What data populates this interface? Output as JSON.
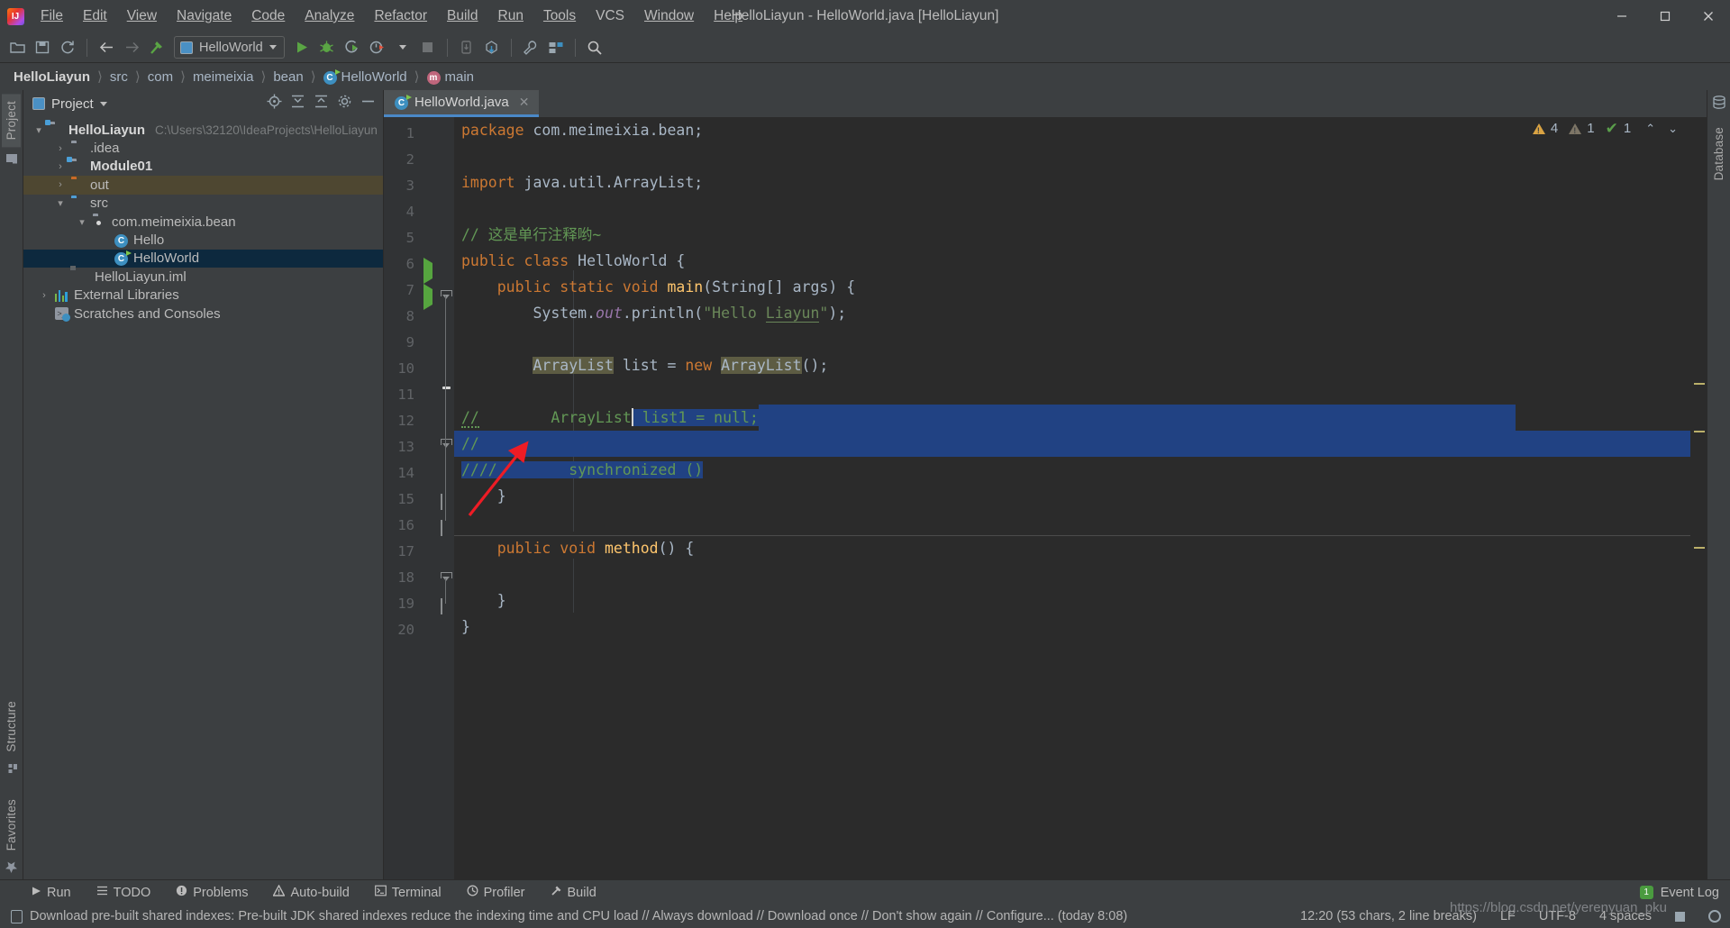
{
  "window": {
    "title": "HelloLiayun - HelloWorld.java [HelloLiayun]",
    "minimize": "—",
    "maximize": "❐",
    "close": "✕"
  },
  "menubar": [
    {
      "label": "File"
    },
    {
      "label": "Edit"
    },
    {
      "label": "View"
    },
    {
      "label": "Navigate"
    },
    {
      "label": "Code"
    },
    {
      "label": "Analyze"
    },
    {
      "label": "Refactor"
    },
    {
      "label": "Build"
    },
    {
      "label": "Run"
    },
    {
      "label": "Tools"
    },
    {
      "label": "VCS"
    },
    {
      "label": "Window"
    },
    {
      "label": "Help"
    }
  ],
  "toolbar": {
    "open_icon": "open-folder-icon",
    "save_icon": "save-icon",
    "sync_icon": "sync-icon",
    "back_icon": "back-arrow-icon",
    "forward_icon": "forward-arrow-icon",
    "build_icon": "hammer-icon",
    "run_config": "HelloWorld",
    "run_icon": "run-icon",
    "debug_icon": "debug-icon",
    "coverage_icon": "run-with-coverage-icon",
    "profile_icon": "profile-icon",
    "stop_icon": "stop-icon",
    "update_icon": "update-project-icon",
    "commit_icon": "commit-icon",
    "settings_icon": "wrench-icon",
    "project-structure_icon": "project-structure-icon",
    "search_icon": "search-everywhere-icon"
  },
  "breadcrumb": [
    {
      "label": "HelloLiayun",
      "bold": true
    },
    {
      "label": "src"
    },
    {
      "label": "com"
    },
    {
      "label": "meimeixia"
    },
    {
      "label": "bean"
    },
    {
      "label": "HelloWorld",
      "icon": "class-icon"
    },
    {
      "label": "main",
      "icon": "method-icon"
    }
  ],
  "left_rail": [
    {
      "label": "Project",
      "active": true,
      "icon": "project-icon"
    },
    {
      "label": "Structure",
      "active": false,
      "icon": "structure-icon"
    },
    {
      "label": "Favorites",
      "active": false,
      "icon": "star-icon"
    }
  ],
  "right_rail": [
    {
      "label": "Database",
      "icon": "database-icon"
    }
  ],
  "project_panel": {
    "title": "Project",
    "actions": [
      "locate-icon",
      "collapse-all-icon",
      "expand-icon",
      "settings-gear-icon",
      "hide-icon"
    ],
    "tree": [
      {
        "indent": 0,
        "arrow": "⌄",
        "icon": "module-folder",
        "label": "HelloLiayun",
        "bold": true,
        "path": "C:\\Users\\32120\\IdeaProjects\\HelloLiayun"
      },
      {
        "indent": 1,
        "arrow": "›",
        "icon": "folder",
        "label": ".idea"
      },
      {
        "indent": 1,
        "arrow": "›",
        "icon": "module-folder",
        "label": "Module01",
        "bold": true
      },
      {
        "indent": 1,
        "arrow": "›",
        "icon": "folder-orange",
        "label": "out",
        "highlight": true
      },
      {
        "indent": 1,
        "arrow": "⌄",
        "icon": "folder-blue",
        "label": "src"
      },
      {
        "indent": 2,
        "arrow": "⌄",
        "icon": "package",
        "label": "com.meimeixia.bean"
      },
      {
        "indent": 3,
        "arrow": "",
        "icon": "class",
        "label": "Hello"
      },
      {
        "indent": 3,
        "arrow": "",
        "icon": "class-runnable",
        "label": "HelloWorld",
        "selected": true
      },
      {
        "indent": 2,
        "arrow": "",
        "icon": "iml",
        "label": "HelloLiayun.iml"
      },
      {
        "indent": 0,
        "arrow": "›",
        "icon": "libraries",
        "label": "External Libraries"
      },
      {
        "indent": 0,
        "arrow": "",
        "icon": "scratches",
        "label": "Scratches and Consoles"
      }
    ]
  },
  "editor": {
    "tab": {
      "label": "HelloWorld.java",
      "icon": "java-class-icon",
      "close": "✕"
    },
    "inspections": {
      "warning_count": "4",
      "weak_warning_count": "1",
      "ok_count": "1",
      "up_arrow": "⌃",
      "down_arrow": "⌄"
    },
    "lines": [
      {
        "n": 1,
        "tokens": [
          {
            "t": "package",
            "c": "kw"
          },
          {
            "t": " com.meimeixia.bean;",
            "c": "txt"
          }
        ]
      },
      {
        "n": 2,
        "tokens": []
      },
      {
        "n": 3,
        "tokens": [
          {
            "t": "import",
            "c": "kw"
          },
          {
            "t": " java.util.ArrayList;",
            "c": "txt"
          }
        ]
      },
      {
        "n": 4,
        "tokens": []
      },
      {
        "n": 5,
        "tokens": [
          {
            "t": "// 这是单行注释哟~",
            "c": "cmt"
          }
        ]
      },
      {
        "n": 6,
        "tokens": [
          {
            "t": "public class",
            "c": "kw"
          },
          {
            "t": " HelloWorld {",
            "c": "txt"
          }
        ],
        "runnable": true
      },
      {
        "n": 7,
        "tokens": [
          {
            "t": "    ",
            "c": "txt"
          },
          {
            "t": "public static void",
            "c": "kw"
          },
          {
            "t": " ",
            "c": "txt"
          },
          {
            "t": "main",
            "c": "mtd"
          },
          {
            "t": "(String[] args) {",
            "c": "txt"
          }
        ],
        "runnable": true,
        "fold": "top"
      },
      {
        "n": 8,
        "tokens": [
          {
            "t": "        System.",
            "c": "txt"
          },
          {
            "t": "out",
            "c": "fld"
          },
          {
            "t": ".println(",
            "c": "txt"
          },
          {
            "t": "\"Hello Liayun\"",
            "c": "str"
          },
          {
            "t": ");",
            "c": "txt"
          }
        ]
      },
      {
        "n": 9,
        "tokens": []
      },
      {
        "n": 10,
        "tokens": [
          {
            "t": "        ",
            "c": "txt"
          },
          {
            "t": "ArrayList",
            "c": "txt",
            "occ": true
          },
          {
            "t": " list = ",
            "c": "txt"
          },
          {
            "t": "new",
            "c": "kw"
          },
          {
            "t": " ",
            "c": "txt"
          },
          {
            "t": "ArrayList",
            "c": "txt",
            "occ": true
          },
          {
            "t": "();",
            "c": "txt"
          }
        ]
      },
      {
        "n": 11,
        "tokens": [],
        "bulb": true
      },
      {
        "n": 12,
        "tokens": [
          {
            "t": "//        ArrayList",
            "c": "cmt"
          },
          {
            "t": " list1 = null;",
            "c": "cmt"
          }
        ],
        "fold": "arrow",
        "selected_from_col": 22
      },
      {
        "n": 13,
        "tokens": [
          {
            "t": "//",
            "c": "cmt"
          }
        ],
        "selected": true
      },
      {
        "n": 14,
        "tokens": [
          {
            "t": "////        synchronized ()",
            "c": "cmt"
          }
        ],
        "selected": true,
        "fold": "bottom"
      },
      {
        "n": 15,
        "tokens": [
          {
            "t": "    }",
            "c": "txt"
          }
        ],
        "fold": "bottom"
      },
      {
        "n": 16,
        "tokens": []
      },
      {
        "n": 17,
        "tokens": [
          {
            "t": "    ",
            "c": "txt"
          },
          {
            "t": "public void",
            "c": "kw"
          },
          {
            "t": " ",
            "c": "txt"
          },
          {
            "t": "method",
            "c": "mtd"
          },
          {
            "t": "() {",
            "c": "txt"
          }
        ],
        "fold": "top"
      },
      {
        "n": 18,
        "tokens": []
      },
      {
        "n": 19,
        "tokens": [
          {
            "t": "    }",
            "c": "txt"
          }
        ],
        "fold": "bottom"
      },
      {
        "n": 20,
        "tokens": [
          {
            "t": "}",
            "c": "txt"
          }
        ]
      }
    ]
  },
  "bottom_bar": {
    "items": [
      {
        "label": "Run",
        "icon": "run-icon"
      },
      {
        "label": "TODO",
        "icon": "todo-icon"
      },
      {
        "label": "Problems",
        "icon": "problems-icon"
      },
      {
        "label": "Auto-build",
        "icon": "auto-build-icon"
      },
      {
        "label": "Terminal",
        "icon": "terminal-icon"
      },
      {
        "label": "Profiler",
        "icon": "profiler-icon"
      },
      {
        "label": "Build",
        "icon": "build-icon"
      }
    ],
    "event_log": {
      "label": "Event Log",
      "badge": "1"
    }
  },
  "status_bar": {
    "message": "Download pre-built shared indexes: Pre-built JDK shared indexes reduce the indexing time and CPU load // Always download // Download once // Don't show again // Configure... (today 8:08)",
    "message_icon": "notification-icon",
    "caret_position": "12:20 (53 chars, 2 line breaks)",
    "line_separator": "LF",
    "encoding": "UTF-8",
    "indent": "4 spaces",
    "lock_icon": "read-only-icon",
    "gear_icon": "settings-gear-icon"
  },
  "watermark": "https://blog.csdn.net/yerenyuan_pku",
  "colors": {
    "accent": "#4a88c7",
    "selection": "#214283",
    "tree_selection": "#0d293e",
    "keyword": "#cc7832",
    "comment": "#629755",
    "string": "#6a8759",
    "text": "#a9b7c6",
    "editor_bg": "#2b2b2b",
    "panel_bg": "#3c3f41",
    "annotation_arrow": "#ee1c25"
  }
}
